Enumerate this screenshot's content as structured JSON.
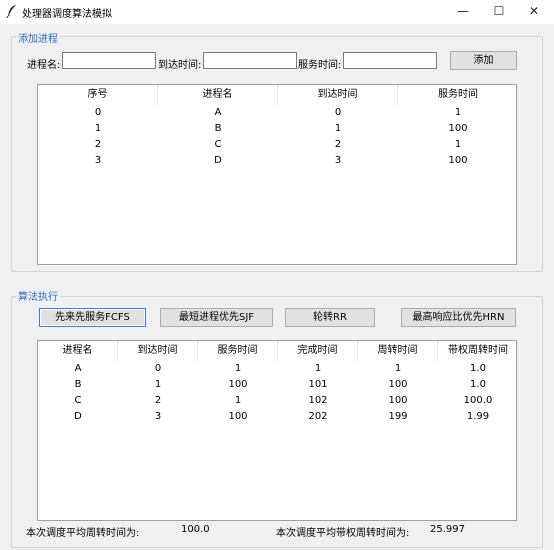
{
  "window": {
    "title": "处理器调度算法模拟",
    "min_glyph": "—",
    "max_glyph": "☐",
    "close_glyph": "✕"
  },
  "add_section": {
    "label": "添加进程",
    "name_label": "进程名:",
    "arrival_label": "到达时间:",
    "service_label": "服务时间:",
    "name_value": "",
    "arrival_value": "",
    "service_value": "",
    "add_button": "添加"
  },
  "process_table": {
    "columns": [
      "序号",
      "进程名",
      "到达时间",
      "服务时间"
    ],
    "rows": [
      [
        "0",
        "A",
        "0",
        "1"
      ],
      [
        "1",
        "B",
        "1",
        "100"
      ],
      [
        "2",
        "C",
        "2",
        "1"
      ],
      [
        "3",
        "D",
        "3",
        "100"
      ]
    ]
  },
  "algo_section": {
    "label": "算法执行",
    "buttons": [
      "先来先服务FCFS",
      "最短进程优先SJF",
      "轮转RR",
      "最高响应比优先HRN"
    ]
  },
  "result_table": {
    "columns": [
      "进程名",
      "到达时间",
      "服务时间",
      "完成时间",
      "周转时间",
      "带权周转时间"
    ],
    "rows": [
      [
        "A",
        "0",
        "1",
        "1",
        "1",
        "1.0"
      ],
      [
        "B",
        "1",
        "100",
        "101",
        "100",
        "1.0"
      ],
      [
        "C",
        "2",
        "1",
        "102",
        "100",
        "100.0"
      ],
      [
        "D",
        "3",
        "100",
        "202",
        "199",
        "1.99"
      ]
    ]
  },
  "summary": {
    "avg_turnaround_label": "本次调度平均周转时间为:",
    "avg_turnaround_value": "100.0",
    "avg_weighted_label": "本次调度平均带权周转时间为:",
    "avg_weighted_value": "25.997"
  }
}
